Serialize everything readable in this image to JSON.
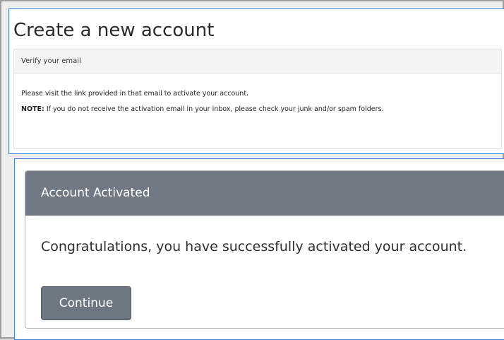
{
  "create_account": {
    "title": "Create a new account",
    "verify_header": "Verify your email",
    "instruction": "Please visit the link provided in that email to activate your account.",
    "note_label": "NOTE:",
    "note_text": " If you do not receive the activation email in your inbox, please check your junk and/or spam folders."
  },
  "account_activated": {
    "header": "Account Activated",
    "message": "Congratulations, you have successfully activated your account.",
    "continue_label": "Continue"
  },
  "colors": {
    "panel_border": "#3d7fd1",
    "card_header": "#717a84",
    "button": "#6d7782"
  }
}
